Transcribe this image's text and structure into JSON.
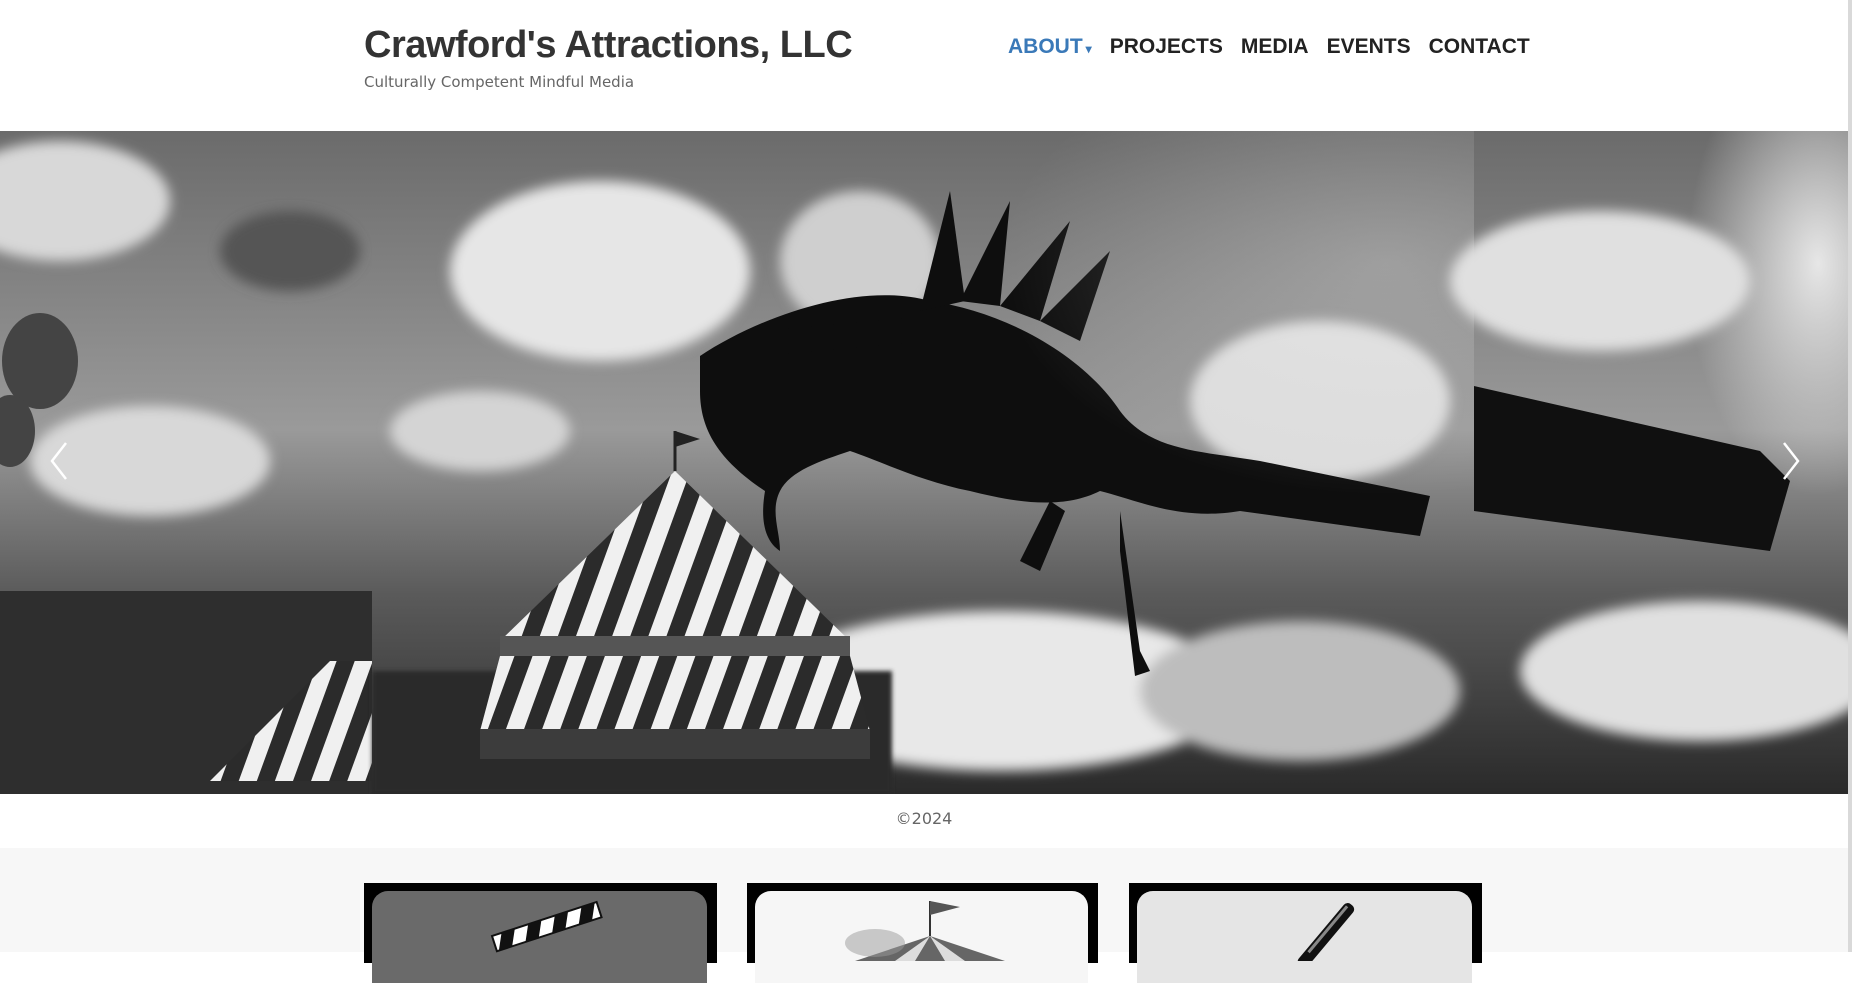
{
  "header": {
    "title": "Crawford's Attractions, LLC",
    "tagline": "Culturally Competent Mindful Media"
  },
  "nav": {
    "items": [
      {
        "label": "ABOUT",
        "active": true,
        "has_dropdown": true
      },
      {
        "label": "PROJECTS"
      },
      {
        "label": "MEDIA"
      },
      {
        "label": "EVENTS"
      },
      {
        "label": "CONTACT"
      }
    ],
    "caret": "▾"
  },
  "hero": {
    "prev_icon": "chevron-left-icon",
    "next_icon": "chevron-right-icon"
  },
  "footer": {
    "copyright": "©2024"
  },
  "cards": [
    {
      "icon": "clapperboard-icon"
    },
    {
      "icon": "circus-tent-icon"
    },
    {
      "icon": "pen-icon"
    }
  ],
  "colors": {
    "accent": "#3a79b8",
    "text": "#222222",
    "muted": "#666666",
    "section_bg": "#f7f7f7"
  }
}
